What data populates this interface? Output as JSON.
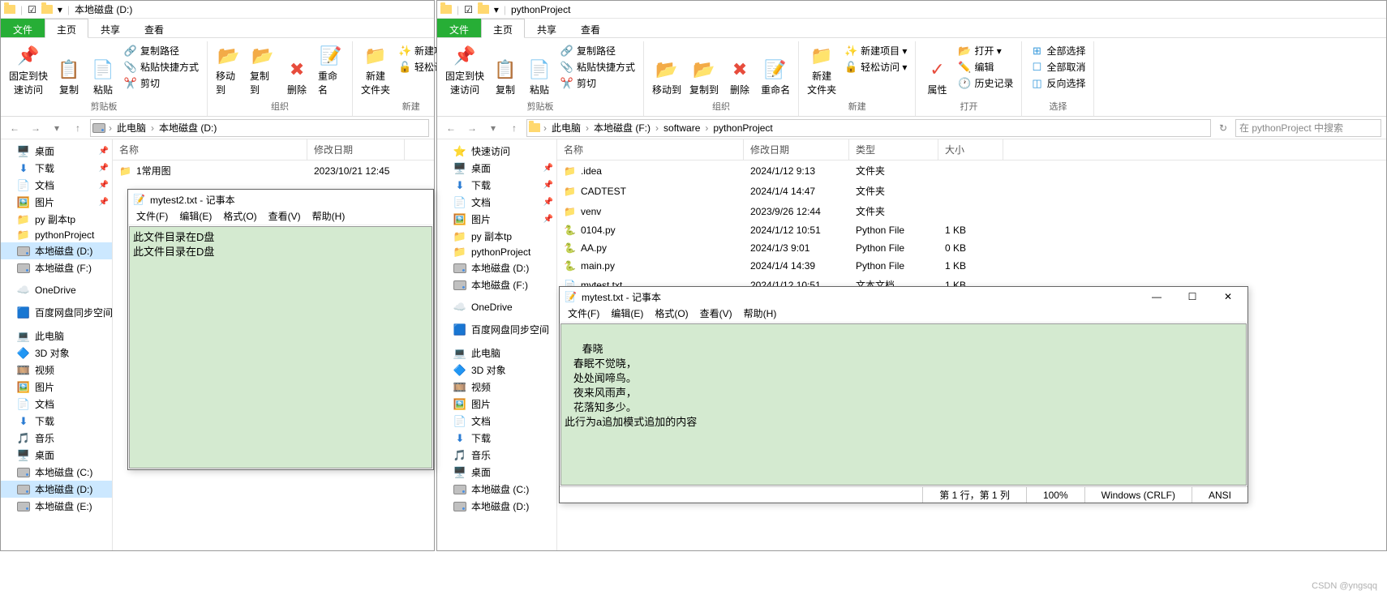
{
  "left_explorer": {
    "title_path": "本地磁盘 (D:)",
    "tabs": {
      "file": "文件",
      "home": "主页",
      "share": "共享",
      "view": "查看"
    },
    "ribbon": {
      "pin": "固定到快\n速访问",
      "copy": "复制",
      "paste": "粘贴",
      "copy_path": "复制路径",
      "paste_shortcut": "粘贴快捷方式",
      "cut": "剪切",
      "moveto": "移动到",
      "copyto": "复制到",
      "delete": "删除",
      "rename": "重命名",
      "newfolder": "新建\n文件夹",
      "newitem": "新建项目 ▾",
      "easyaccess": "轻松访问 ▾",
      "g_clipboard": "剪贴板",
      "g_organize": "组织",
      "g_new": "新建"
    },
    "breadcrumbs": [
      "此电脑",
      "本地磁盘 (D:)"
    ],
    "tree": [
      {
        "icon": "🖥️",
        "label": "桌面",
        "pin": true
      },
      {
        "icon": "⬇",
        "label": "下载",
        "pin": true,
        "color": "#2b7cd3"
      },
      {
        "icon": "📄",
        "label": "文档",
        "pin": true
      },
      {
        "icon": "🖼️",
        "label": "图片",
        "pin": true
      },
      {
        "icon": "📁",
        "label": "py 副本tp"
      },
      {
        "icon": "📁",
        "label": "pythonProject"
      },
      {
        "icon": "drive",
        "label": "本地磁盘 (D:)",
        "selected": true
      },
      {
        "icon": "drive",
        "label": "本地磁盘 (F:)"
      },
      {
        "spacer": true
      },
      {
        "icon": "☁️",
        "label": "OneDrive",
        "color": "#0078d4"
      },
      {
        "spacer": true
      },
      {
        "icon": "🟦",
        "label": "百度网盘同步空间"
      },
      {
        "spacer": true
      },
      {
        "icon": "💻",
        "label": "此电脑"
      },
      {
        "icon": "🔷",
        "label": "3D 对象"
      },
      {
        "icon": "🎞️",
        "label": "视频"
      },
      {
        "icon": "🖼️",
        "label": "图片"
      },
      {
        "icon": "📄",
        "label": "文档"
      },
      {
        "icon": "⬇",
        "label": "下载",
        "color": "#2b7cd3"
      },
      {
        "icon": "🎵",
        "label": "音乐",
        "color": "#2b7cd3"
      },
      {
        "icon": "🖥️",
        "label": "桌面"
      },
      {
        "icon": "drive",
        "label": "本地磁盘 (C:)"
      },
      {
        "icon": "drive",
        "label": "本地磁盘 (D:)",
        "selected": true
      },
      {
        "icon": "drive",
        "label": "本地磁盘 (E:)"
      }
    ],
    "columns": {
      "name": "名称",
      "modified": "修改日期"
    },
    "rows": [
      {
        "name": "1常用图",
        "modified": "2023/10/21 12:45"
      }
    ]
  },
  "right_explorer": {
    "title_path": "pythonProject",
    "tabs": {
      "file": "文件",
      "home": "主页",
      "share": "共享",
      "view": "查看"
    },
    "ribbon": {
      "pin": "固定到快\n速访问",
      "copy": "复制",
      "paste": "粘贴",
      "copy_path": "复制路径",
      "paste_shortcut": "粘贴快捷方式",
      "cut": "剪切",
      "moveto": "移动到",
      "copyto": "复制到",
      "delete": "删除",
      "rename": "重命名",
      "newfolder": "新建\n文件夹",
      "newitem": "新建项目 ▾",
      "easyaccess": "轻松访问 ▾",
      "properties": "属性",
      "open": "打开 ▾",
      "edit": "编辑",
      "history": "历史记录",
      "selectall": "全部选择",
      "selectnone": "全部取消",
      "invert": "反向选择",
      "g_clipboard": "剪贴板",
      "g_organize": "组织",
      "g_new": "新建",
      "g_open": "打开",
      "g_select": "选择"
    },
    "breadcrumbs": [
      "此电脑",
      "本地磁盘 (F:)",
      "software",
      "pythonProject"
    ],
    "search_placeholder": "在 pythonProject 中搜索",
    "tree": [
      {
        "icon": "⭐",
        "label": "快速访问",
        "color": "#2b7cd3"
      },
      {
        "icon": "🖥️",
        "label": "桌面",
        "pin": true
      },
      {
        "icon": "⬇",
        "label": "下载",
        "pin": true,
        "color": "#2b7cd3"
      },
      {
        "icon": "📄",
        "label": "文档",
        "pin": true
      },
      {
        "icon": "🖼️",
        "label": "图片",
        "pin": true
      },
      {
        "icon": "📁",
        "label": "py 副本tp"
      },
      {
        "icon": "📁",
        "label": "pythonProject"
      },
      {
        "icon": "drive",
        "label": "本地磁盘 (D:)"
      },
      {
        "icon": "drive",
        "label": "本地磁盘 (F:)"
      },
      {
        "spacer": true
      },
      {
        "icon": "☁️",
        "label": "OneDrive",
        "color": "#0078d4"
      },
      {
        "spacer": true
      },
      {
        "icon": "🟦",
        "label": "百度网盘同步空间"
      },
      {
        "spacer": true
      },
      {
        "icon": "💻",
        "label": "此电脑"
      },
      {
        "icon": "🔷",
        "label": "3D 对象"
      },
      {
        "icon": "🎞️",
        "label": "视频"
      },
      {
        "icon": "🖼️",
        "label": "图片"
      },
      {
        "icon": "📄",
        "label": "文档"
      },
      {
        "icon": "⬇",
        "label": "下载",
        "color": "#2b7cd3"
      },
      {
        "icon": "🎵",
        "label": "音乐",
        "color": "#2b7cd3"
      },
      {
        "icon": "🖥️",
        "label": "桌面"
      },
      {
        "icon": "drive",
        "label": "本地磁盘 (C:)"
      },
      {
        "icon": "drive",
        "label": "本地磁盘 (D:)"
      }
    ],
    "columns": {
      "name": "名称",
      "modified": "修改日期",
      "type": "类型",
      "size": "大小"
    },
    "rows": [
      {
        "icon": "📁",
        "name": ".idea",
        "modified": "2024/1/12 9:13",
        "type": "文件夹",
        "size": ""
      },
      {
        "icon": "📁",
        "name": "CADTEST",
        "modified": "2024/1/4 14:47",
        "type": "文件夹",
        "size": ""
      },
      {
        "icon": "📁",
        "name": "venv",
        "modified": "2023/9/26 12:44",
        "type": "文件夹",
        "size": ""
      },
      {
        "icon": "🐍",
        "name": "0104.py",
        "modified": "2024/1/12 10:51",
        "type": "Python File",
        "size": "1 KB"
      },
      {
        "icon": "🐍",
        "name": "AA.py",
        "modified": "2024/1/3 9:01",
        "type": "Python File",
        "size": "0 KB"
      },
      {
        "icon": "🐍",
        "name": "main.py",
        "modified": "2024/1/4 14:39",
        "type": "Python File",
        "size": "1 KB"
      },
      {
        "icon": "📄",
        "name": "mytest.txt",
        "modified": "2024/1/12 10:51",
        "type": "文本文档",
        "size": "1 KB"
      }
    ]
  },
  "notepad_left": {
    "title": "mytest2.txt - 记事本",
    "menus": [
      "文件(F)",
      "编辑(E)",
      "格式(O)",
      "查看(V)",
      "帮助(H)"
    ],
    "content": "此文件目录在D盘\n此文件目录在D盘"
  },
  "notepad_right": {
    "title": "mytest.txt - 记事本",
    "menus": [
      "文件(F)",
      "编辑(E)",
      "格式(O)",
      "查看(V)",
      "帮助(H)"
    ],
    "content": "\n      春晓\n   春眠不觉晓，\n   处处闻啼鸟。\n   夜来风雨声，\n   花落知多少。\n此行为a追加模式追加的内容",
    "status": {
      "pos": "第 1 行，第 1 列",
      "zoom": "100%",
      "eol": "Windows (CRLF)",
      "encoding": "ANSI"
    }
  },
  "watermark": "CSDN @yngsqq"
}
